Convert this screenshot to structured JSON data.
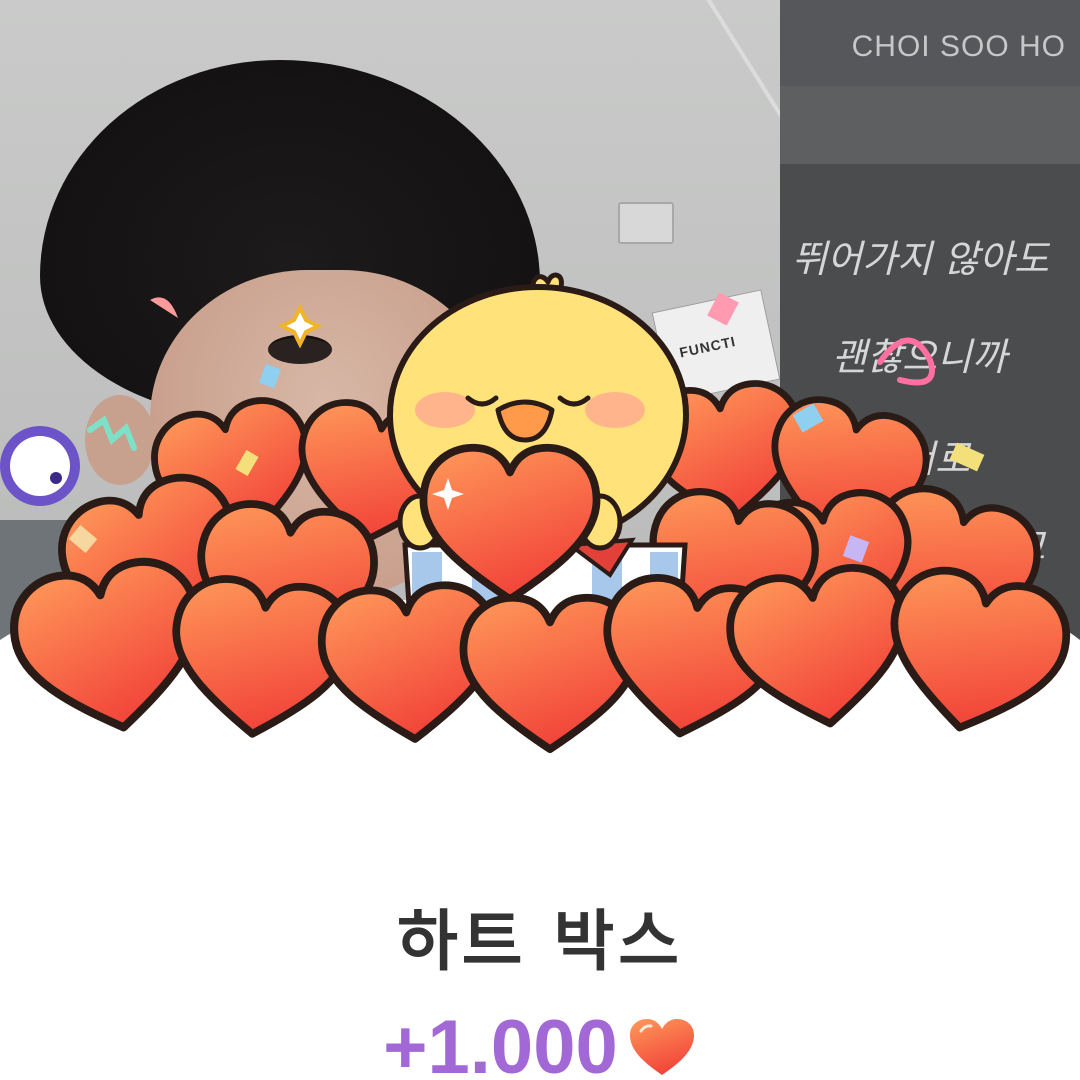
{
  "board": {
    "name": "CHOI SOO HO",
    "lines": [
      "뛰어가지 않아도",
      "괜찮으니까",
      "서로",
      "고"
    ]
  },
  "reward": {
    "title": "하트 박스",
    "amount": "+1.000"
  },
  "colors": {
    "heart_top": "#ff9a5a",
    "heart_bottom": "#f2463a",
    "amount": "#a268d6",
    "title": "#333333",
    "chick": "#ffe27a"
  },
  "icons": {
    "amount_icon": "heart-icon",
    "sticker": "chick-holding-heart",
    "badge": "eye-badge-icon"
  }
}
